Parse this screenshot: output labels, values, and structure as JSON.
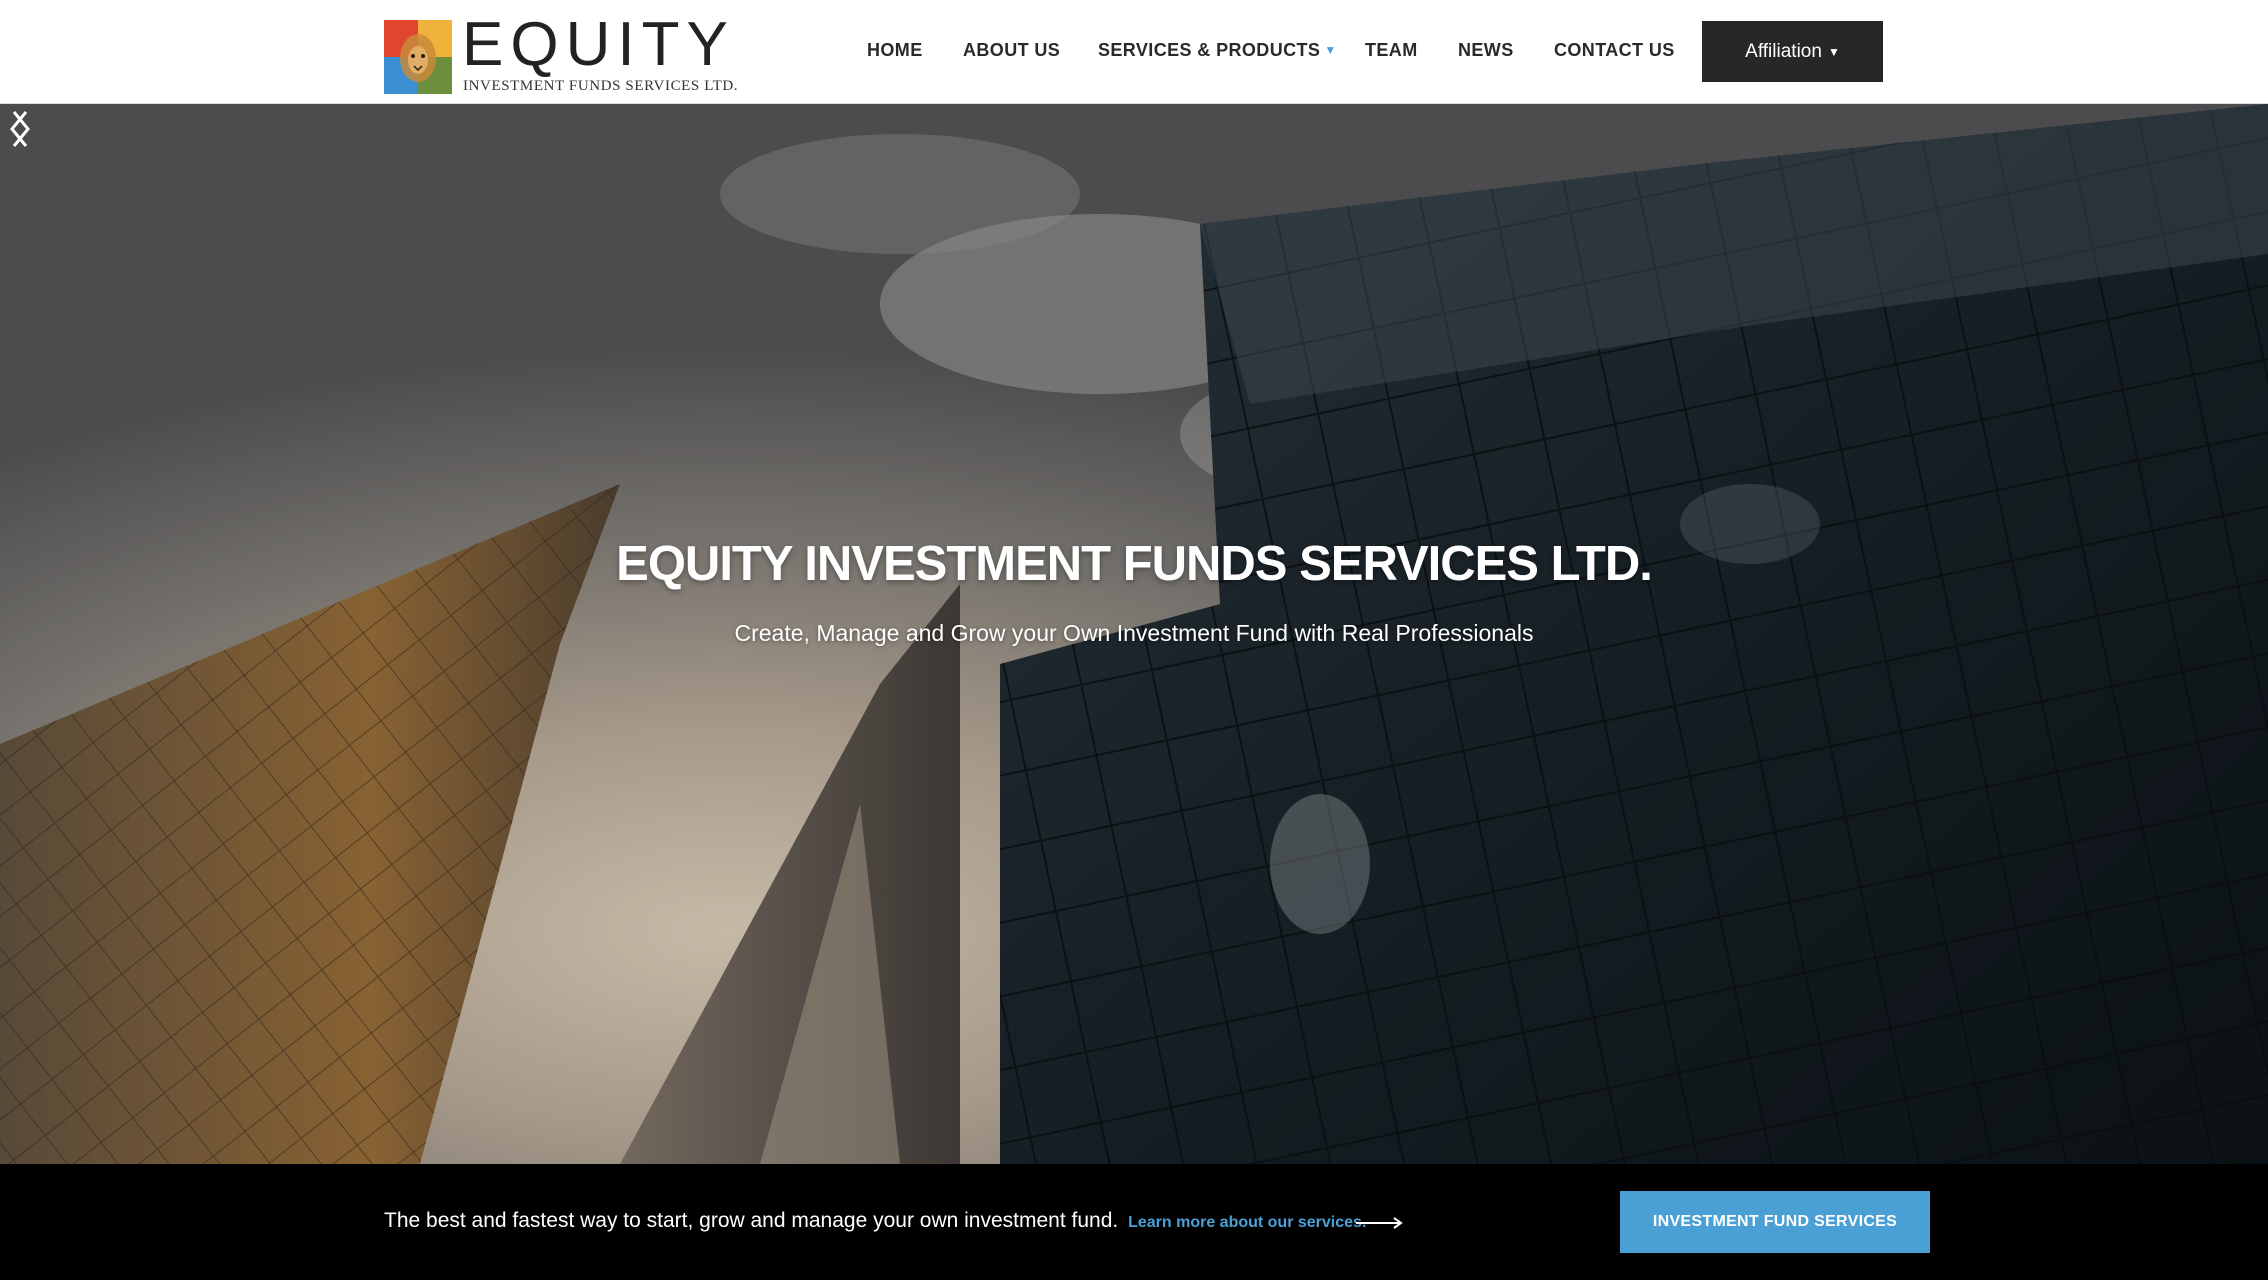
{
  "brand": {
    "name": "EQUITY",
    "subtitle": "INVESTMENT FUNDS SERVICES LTD.",
    "logo_icon": "lion-logo-icon"
  },
  "nav": {
    "items": [
      {
        "label": "HOME"
      },
      {
        "label": "ABOUT US"
      },
      {
        "label": "SERVICES & PRODUCTS",
        "has_dropdown": true
      },
      {
        "label": "TEAM"
      },
      {
        "label": "NEWS"
      },
      {
        "label": "CONTACT US"
      }
    ],
    "affiliation_label": "Affiliation"
  },
  "hero": {
    "title": "EQUITY INVESTMENT FUNDS SERVICES LTD.",
    "subtitle": "Create, Manage and Grow your Own Investment Fund with Real Professionals",
    "prev_icon": "chevron-left-icon",
    "next_icon": "chevron-right-icon"
  },
  "banner": {
    "text": "The best and fastest way to start, grow and manage your own investment fund.",
    "link_text": "Learn more about our services.",
    "cta_label": "INVESTMENT FUND SERVICES"
  },
  "colors": {
    "accent": "#4a9fd5",
    "affiliation_bg": "#262729",
    "banner_bg": "#000000"
  }
}
